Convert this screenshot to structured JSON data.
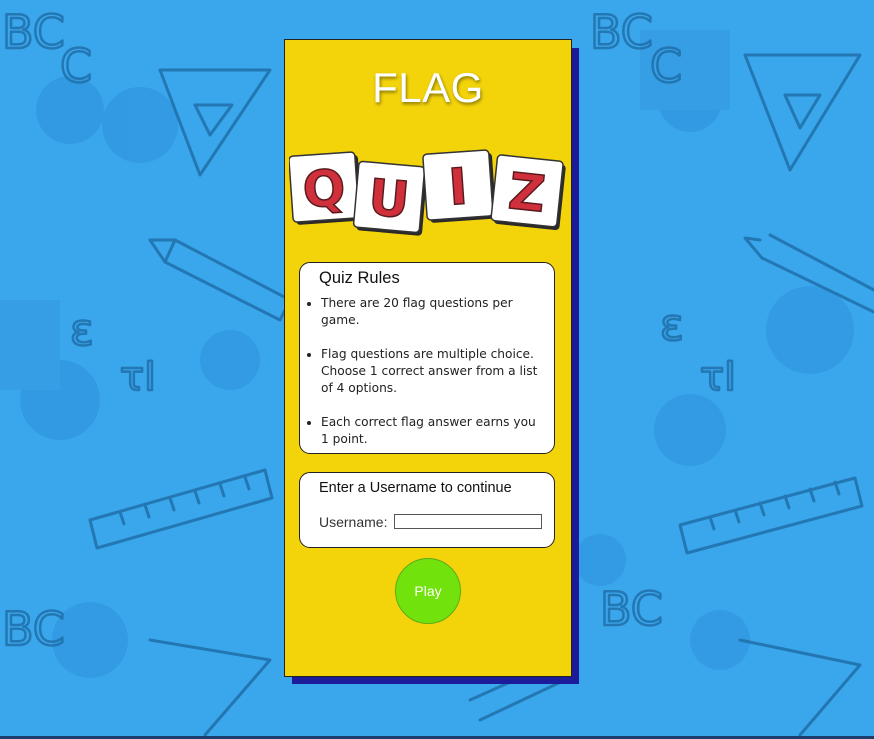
{
  "header": {
    "title": "FLAG",
    "logo_letters": [
      "Q",
      "U",
      "I",
      "Z"
    ]
  },
  "rules": {
    "heading": "Quiz Rules",
    "items": [
      "There are 20 flag questions per game.",
      "Flag questions are multiple choice. Choose 1 correct answer from a list of 4 options.",
      "Each correct flag answer earns you 1 point."
    ]
  },
  "username": {
    "prompt": "Enter a Username to continue",
    "label": "Username:",
    "value": "",
    "placeholder": ""
  },
  "play": {
    "label": "Play"
  },
  "colors": {
    "background": "#3aa6ec",
    "card": "#f3d40a",
    "card_shadow": "#1c1c9a",
    "play_button": "#72e20c",
    "tile_letter": "#d0303b"
  },
  "background_doodles": [
    "abc-letters-icon",
    "triangle-ruler-icon",
    "pencil-icon",
    "ruler-icon"
  ]
}
